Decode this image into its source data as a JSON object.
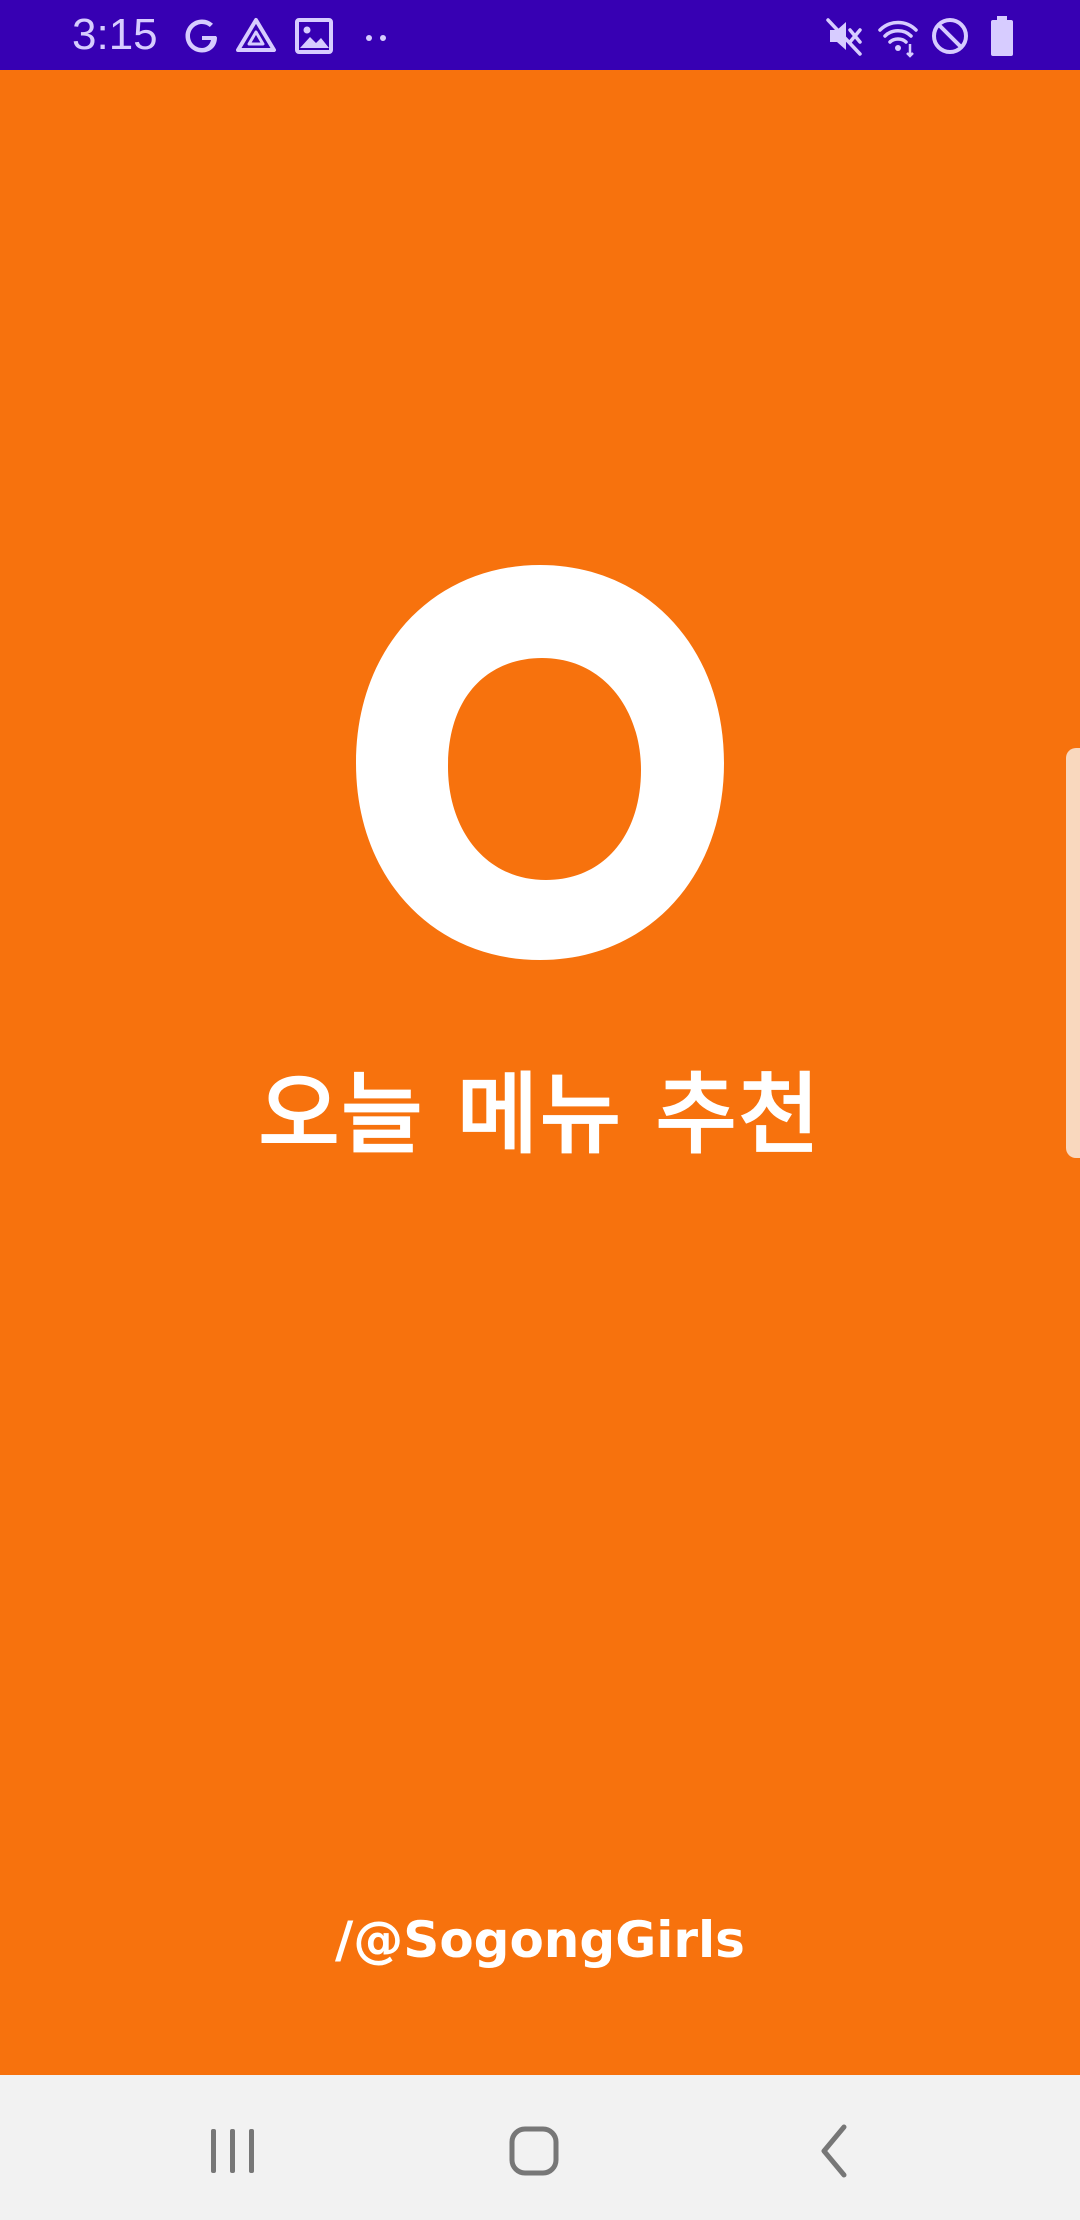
{
  "status_bar": {
    "time": "3:15",
    "background": "#3700B3",
    "left_icons": [
      "google-icon",
      "drive-icon",
      "gallery-icon",
      "more-notifications-icon"
    ],
    "right_icons": [
      "mute-icon",
      "wifi-icon",
      "do-not-disturb-icon",
      "battery-icon"
    ]
  },
  "main": {
    "background": "#F7720D",
    "logo_glyph": "O",
    "title": "오늘 메뉴 추천",
    "handle_tag": "/@SogongGirls"
  },
  "nav_bar": {
    "buttons": [
      "recent-apps",
      "home",
      "back"
    ]
  }
}
